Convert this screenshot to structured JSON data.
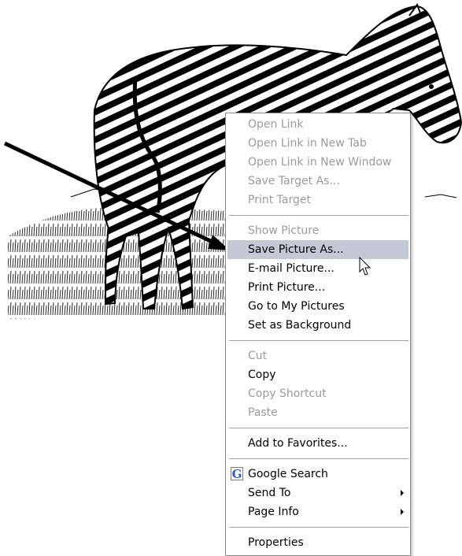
{
  "illustration": {
    "subject": "zebra-sketch",
    "colors": {
      "ink": "#000000",
      "paper": "#ffffff"
    }
  },
  "context_menu": {
    "colors": {
      "highlight": "#c4c9d6",
      "disabled_text": "#9b9b9b",
      "border": "#8a8a8a"
    },
    "groups": [
      [
        {
          "label": "Open Link",
          "enabled": false
        },
        {
          "label": "Open Link in New Tab",
          "enabled": false
        },
        {
          "label": "Open Link in New Window",
          "enabled": false
        },
        {
          "label": "Save Target As...",
          "enabled": false
        },
        {
          "label": "Print Target",
          "enabled": false
        }
      ],
      [
        {
          "label": "Show Picture",
          "enabled": false
        },
        {
          "label": "Save Picture As...",
          "enabled": true,
          "highlighted": true
        },
        {
          "label": "E-mail Picture...",
          "enabled": true
        },
        {
          "label": "Print Picture...",
          "enabled": true
        },
        {
          "label": "Go to My Pictures",
          "enabled": true
        },
        {
          "label": "Set as Background",
          "enabled": true
        }
      ],
      [
        {
          "label": "Cut",
          "enabled": false
        },
        {
          "label": "Copy",
          "enabled": true
        },
        {
          "label": "Copy Shortcut",
          "enabled": false
        },
        {
          "label": "Paste",
          "enabled": false
        }
      ],
      [
        {
          "label": "Add to Favorites...",
          "enabled": true
        }
      ],
      [
        {
          "label": "Google Search",
          "enabled": true,
          "icon": "google-g-icon",
          "icon_glyph": "G"
        },
        {
          "label": "Send To",
          "enabled": true,
          "submenu": true
        },
        {
          "label": "Page Info",
          "enabled": true,
          "submenu": true
        }
      ],
      [
        {
          "label": "Properties",
          "enabled": true
        }
      ]
    ]
  },
  "cursor": {
    "icon": "mouse-pointer-icon"
  },
  "annotation": {
    "icon": "arrow-icon",
    "color": "#000000"
  }
}
